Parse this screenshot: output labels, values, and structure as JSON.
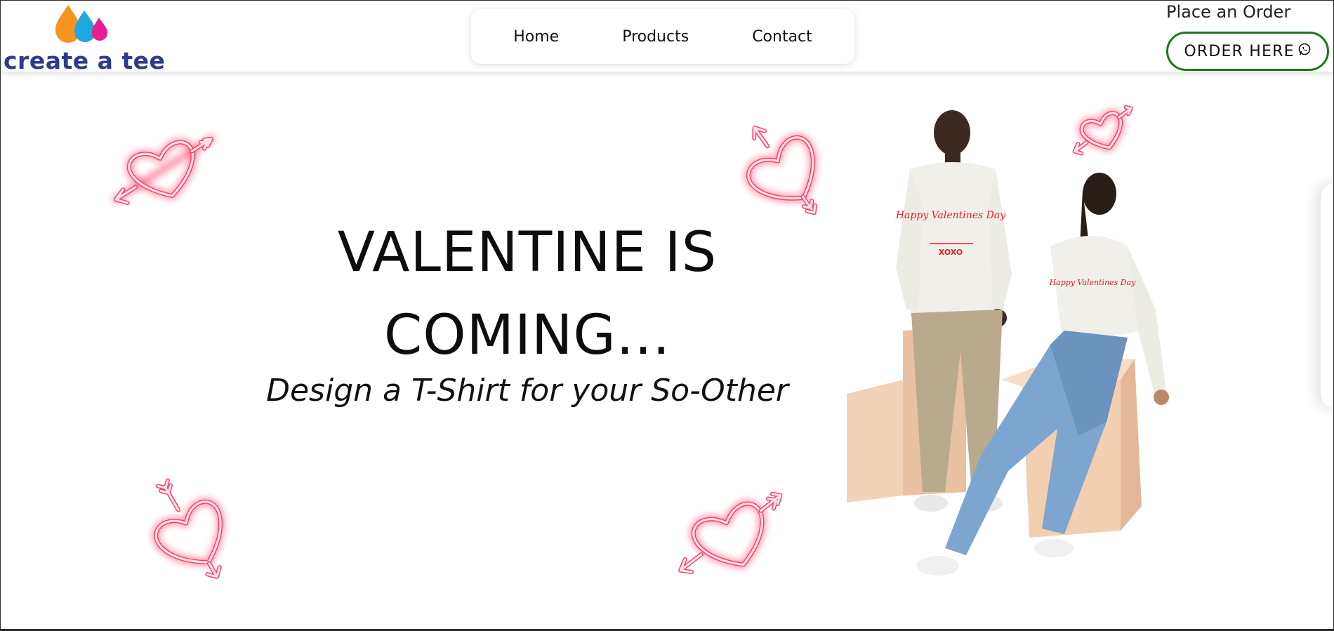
{
  "brand": {
    "name": "create a tee",
    "drop_colors": [
      "#f7941d",
      "#1ea7e1",
      "#ec1d8c"
    ],
    "text_color": "#2e3a8c"
  },
  "nav": {
    "items": [
      {
        "label": "Home"
      },
      {
        "label": "Products"
      },
      {
        "label": "Contact"
      }
    ]
  },
  "order": {
    "caption": "Place an Order",
    "button_label": "ORDER HERE",
    "button_icon": "whatsapp-icon",
    "accent": "#1a7a1a"
  },
  "hero": {
    "title_line1": "VALENTINE IS",
    "title_line2": "COMING...",
    "subtitle": "Design a T-Shirt for your So-Other"
  },
  "decor": {
    "heart_icon": "neon-heart-arrow-icon",
    "heart_color": "#ff2d55",
    "shirt_print": "Happy Valentines Day",
    "shirt_sub": "XOXO"
  }
}
